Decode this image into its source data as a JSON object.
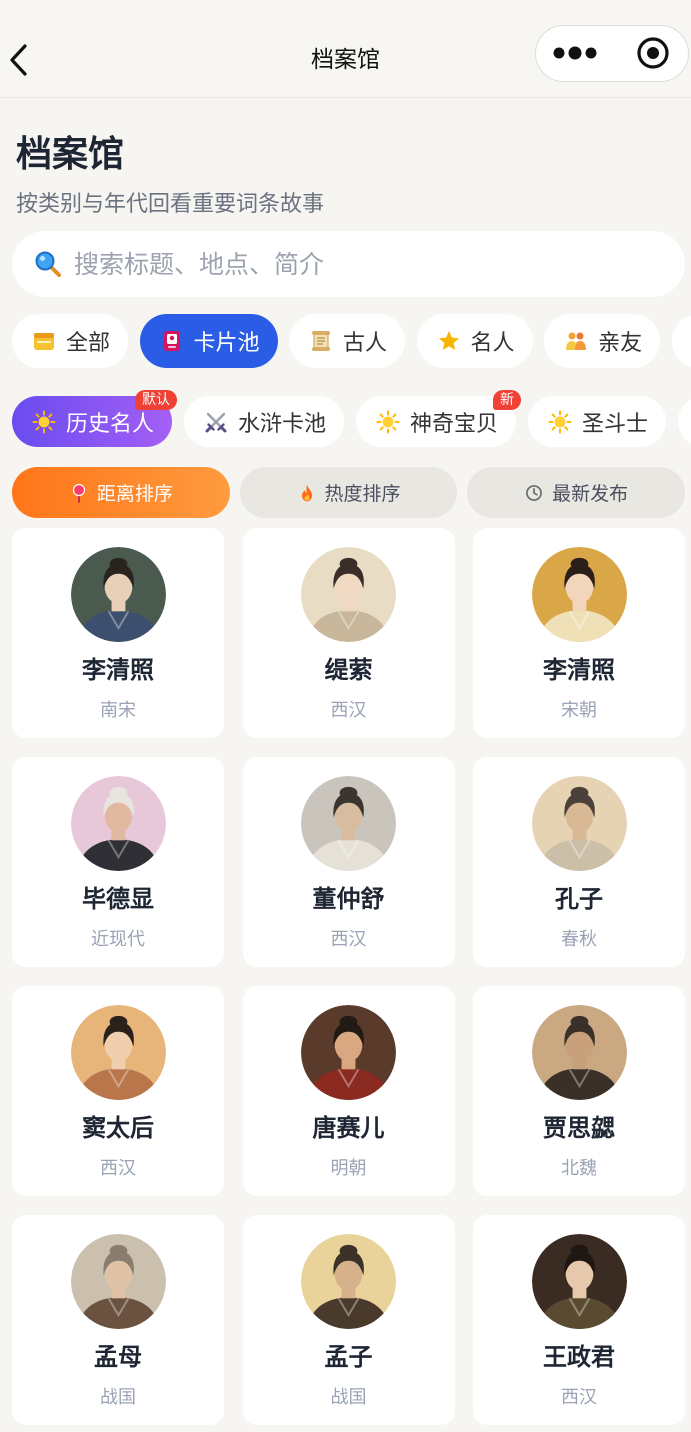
{
  "theme": {
    "background": "#f6f5f1",
    "primary": "#2b5ce6",
    "pool_active_from": "#6a4cf0",
    "pool_active_to": "#a45ff5",
    "sort_active_from": "#ff7518",
    "sort_active_to": "#ff9b3f",
    "badge": "#ef4136"
  },
  "nav": {
    "title": "档案馆",
    "icons": [
      "back-arrow-icon",
      "more-dots-icon",
      "target-icon"
    ]
  },
  "header": {
    "title": "档案馆",
    "subtitle": "按类别与年代回看重要词条故事"
  },
  "search": {
    "placeholder": "搜索标题、地点、简介",
    "value": "",
    "icon": "search-icon"
  },
  "categories": [
    {
      "label": "全部",
      "icon": "folder-icon",
      "selected": false
    },
    {
      "label": "卡片池",
      "icon": "card-icon",
      "selected": true
    },
    {
      "label": "古人",
      "icon": "scroll-icon",
      "selected": false
    },
    {
      "label": "名人",
      "icon": "star-icon",
      "selected": false
    },
    {
      "label": "亲友",
      "icon": "family-icon",
      "selected": false
    }
  ],
  "pools": [
    {
      "label": "历史名人",
      "icon": "sun-icon",
      "badge": "默认",
      "selected": true
    },
    {
      "label": "水浒卡池",
      "icon": "crossed-swords-icon",
      "selected": false
    },
    {
      "label": "神奇宝贝",
      "icon": "sun-icon",
      "badge": "新",
      "selected": false
    },
    {
      "label": "圣斗士",
      "icon": "sun-icon",
      "selected": false
    }
  ],
  "sort": [
    {
      "label": "距离排序",
      "icon": "pin-icon",
      "selected": true
    },
    {
      "label": "热度排序",
      "icon": "fire-icon",
      "selected": false
    },
    {
      "label": "最新发布",
      "icon": "clock-icon",
      "selected": false
    }
  ],
  "cards": [
    {
      "name": "李清照",
      "era": "南宋",
      "avatar": {
        "bg": "#4a5a4e",
        "robe": "#3d4f6e",
        "skin": "#e8d0b8",
        "hair": "#2a2420"
      }
    },
    {
      "name": "缇萦",
      "era": "西汉",
      "avatar": {
        "bg": "#e9dcc4",
        "robe": "#c9b79b",
        "skin": "#efd9c2",
        "hair": "#3a2e28"
      }
    },
    {
      "name": "李清照",
      "era": "宋朝",
      "avatar": {
        "bg": "#d9a748",
        "robe": "#f0e0b8",
        "skin": "#f1d6bb",
        "hair": "#2b2019"
      }
    },
    {
      "name": "毕德显",
      "era": "近现代",
      "avatar": {
        "bg": "#e7c8d8",
        "robe": "#2f2f35",
        "skin": "#e0b9a0",
        "hair": "#e8e4df"
      }
    },
    {
      "name": "董仲舒",
      "era": "西汉",
      "avatar": {
        "bg": "#c9c5bd",
        "robe": "#e6e1d6",
        "skin": "#d8bca0",
        "hair": "#3b3530"
      }
    },
    {
      "name": "孔子",
      "era": "春秋",
      "avatar": {
        "bg": "#e5d3b3",
        "robe": "#cbbfa8",
        "skin": "#d9b896",
        "hair": "#4a423a"
      }
    },
    {
      "name": "窦太后",
      "era": "西汉",
      "avatar": {
        "bg": "#e7b57a",
        "robe": "#b9764a",
        "skin": "#efcfae",
        "hair": "#2a211b"
      }
    },
    {
      "name": "唐赛儿",
      "era": "明朝",
      "avatar": {
        "bg": "#5a3a2a",
        "robe": "#8a2a20",
        "skin": "#d9a883",
        "hair": "#231a15"
      }
    },
    {
      "name": "贾思勰",
      "era": "北魏",
      "avatar": {
        "bg": "#c9a882",
        "robe": "#3a3028",
        "skin": "#c8a07c",
        "hair": "#3a302a"
      }
    },
    {
      "name": "孟母",
      "era": "战国",
      "avatar": {
        "bg": "#cbbfae",
        "robe": "#6b5240",
        "skin": "#e0c3a6",
        "hair": "#8a7d70"
      }
    },
    {
      "name": "孟子",
      "era": "战国",
      "avatar": {
        "bg": "#e9d39a",
        "robe": "#4a3a2c",
        "skin": "#d6b28c",
        "hair": "#3d3228"
      }
    },
    {
      "name": "王政君",
      "era": "西汉",
      "avatar": {
        "bg": "#3a2c22",
        "robe": "#5a4a30",
        "skin": "#e6c8ac",
        "hair": "#1e1713"
      }
    }
  ]
}
